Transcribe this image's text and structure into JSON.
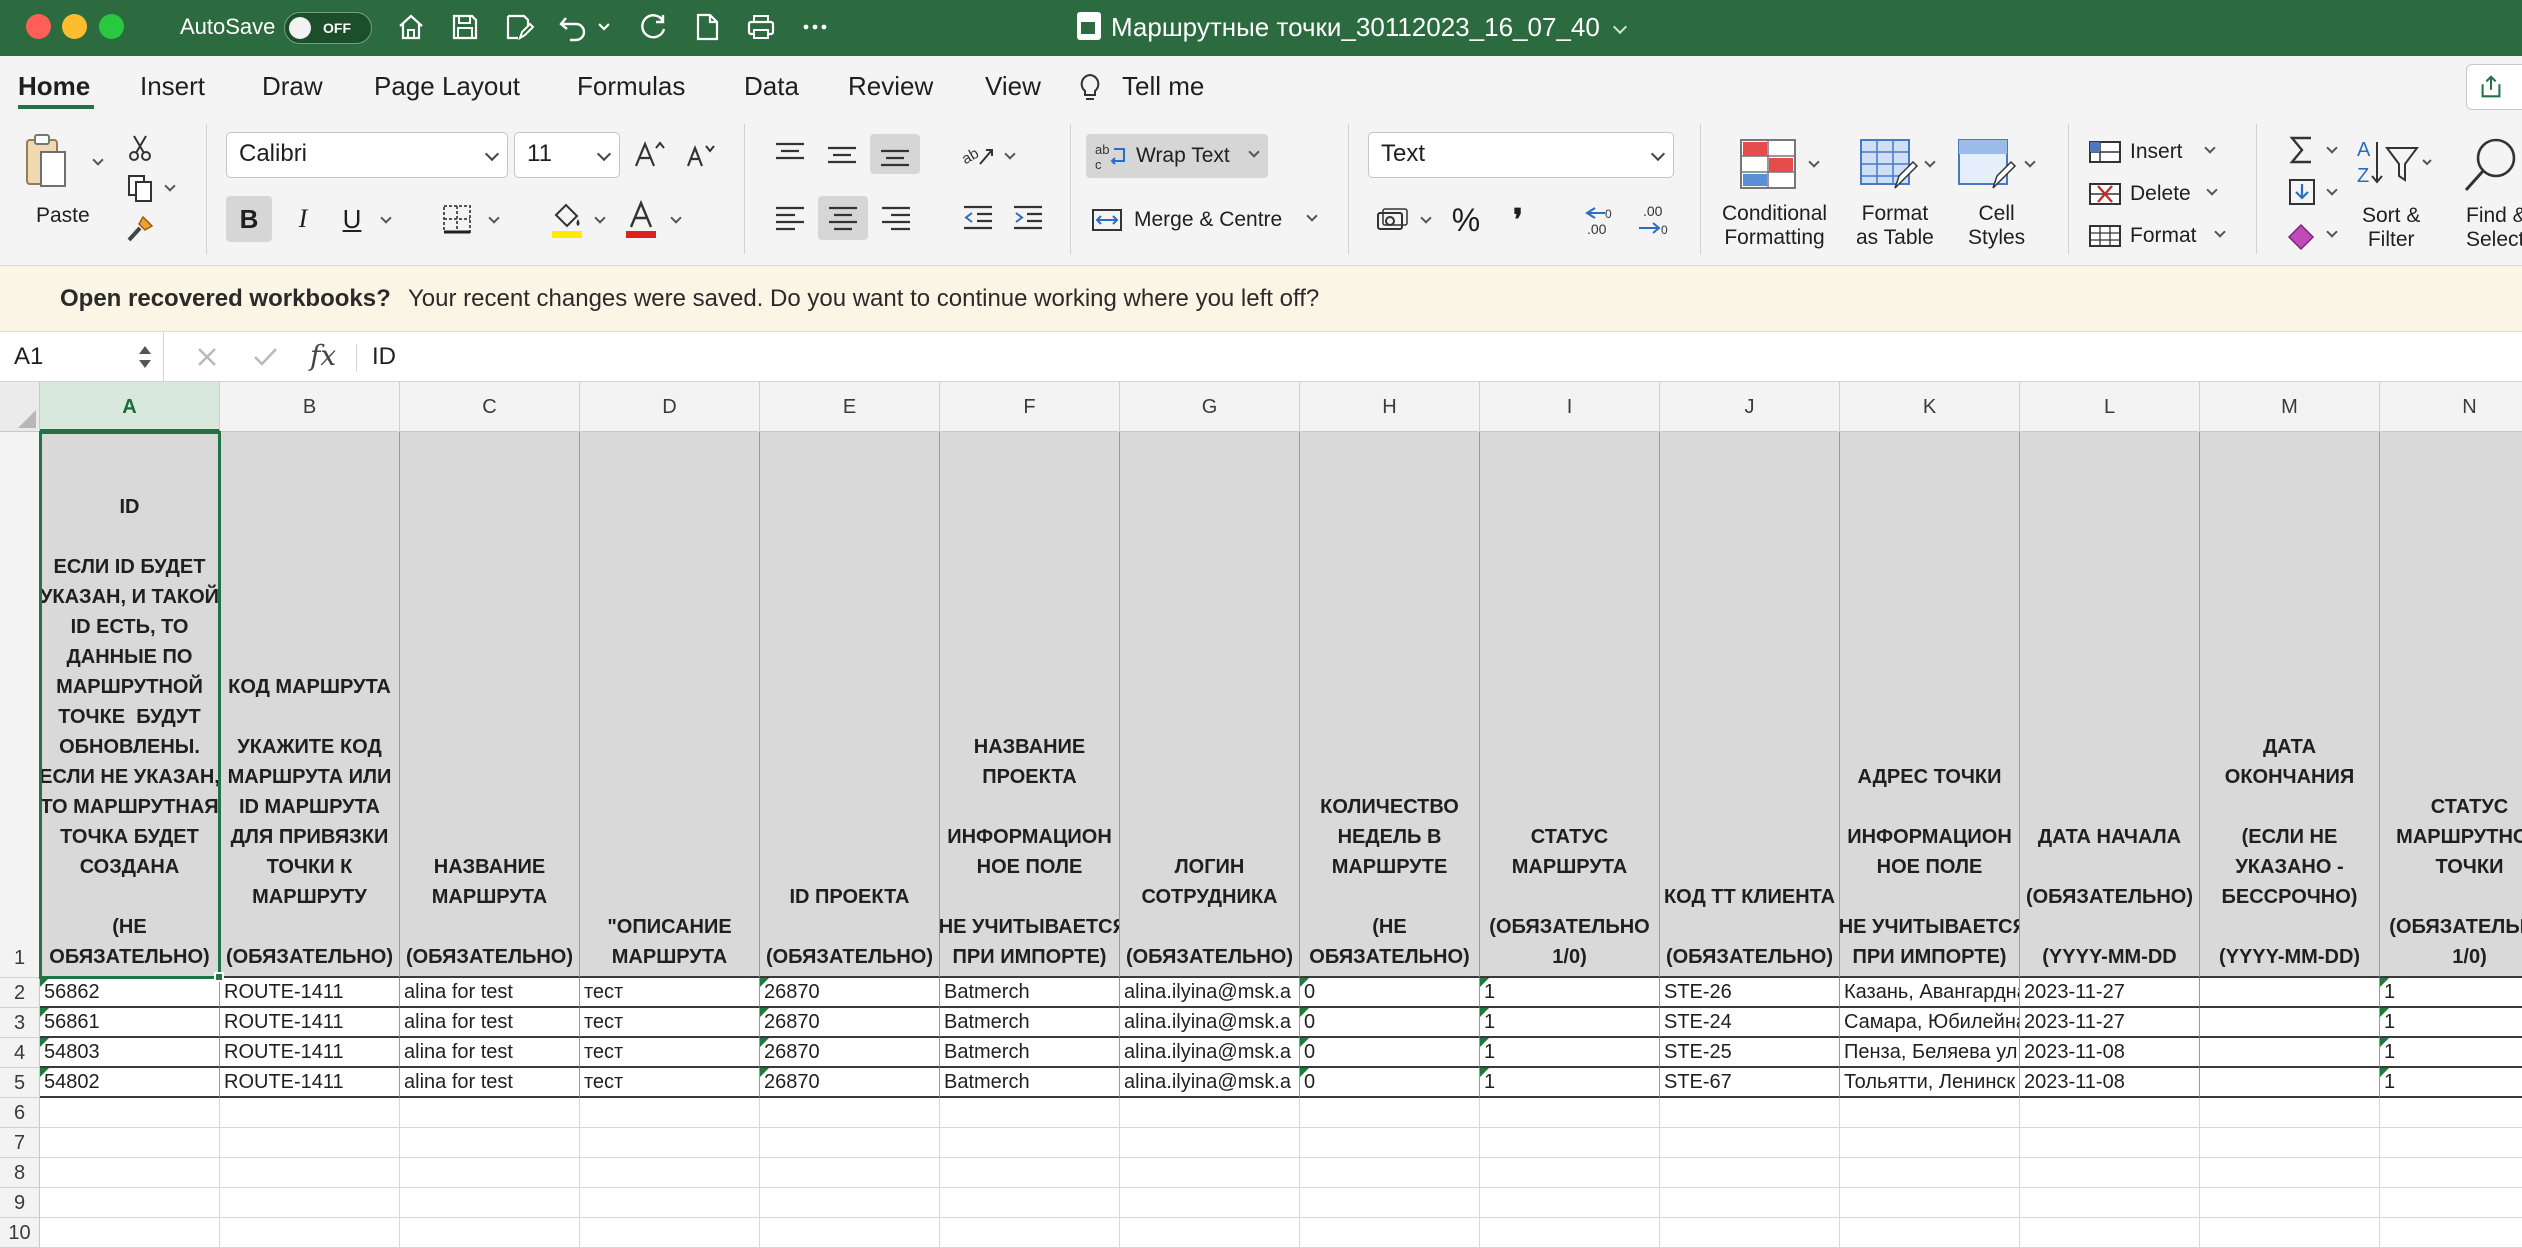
{
  "window": {
    "title": "Маршрутные точки_30112023_16_07_40",
    "autosave_label": "AutoSave",
    "autosave_state": "OFF"
  },
  "menu": {
    "tabs": [
      "Home",
      "Insert",
      "Draw",
      "Page Layout",
      "Formulas",
      "Data",
      "Review",
      "View"
    ],
    "tell_me": "Tell me",
    "active_tab": "Home"
  },
  "ribbon": {
    "paste_label": "Paste",
    "font_name": "Calibri",
    "font_size": "11",
    "wrap_text_label": "Wrap Text",
    "merge_label": "Merge & Centre",
    "number_format": "Text",
    "conditional_formatting_label": [
      "Conditional",
      "Formatting"
    ],
    "format_as_table_label": [
      "Format",
      "as Table"
    ],
    "cell_styles_label": [
      "Cell",
      "Styles"
    ],
    "insert_label": "Insert",
    "delete_label": "Delete",
    "format_label": "Format",
    "sort_filter_label": [
      "Sort &",
      "Filter"
    ],
    "find_select_label": [
      "Find &",
      "Select"
    ],
    "bold": "B",
    "italic": "I",
    "underline": "U",
    "percent": "%",
    "comma": "❜",
    "font_color": "#e0201b",
    "highlight_color": "#ffeb00",
    "accent": "#217346"
  },
  "notification": {
    "title": "Open recovered workbooks?",
    "message": "Your recent changes were saved. Do you want to continue working where you left off?"
  },
  "formula_bar": {
    "cell_ref": "A1",
    "fx": "fx",
    "value": "ID"
  },
  "sheet": {
    "columns": [
      "A",
      "B",
      "C",
      "D",
      "E",
      "F",
      "G",
      "H",
      "I",
      "J",
      "K",
      "L",
      "M",
      "N"
    ],
    "selected_column": "A",
    "row_numbers": [
      "1",
      "2",
      "3",
      "4",
      "5",
      "6",
      "7",
      "8",
      "9",
      "10"
    ],
    "header_cells": [
      [
        "ID",
        "",
        "ЕСЛИ ID БУДЕТ",
        "УКАЗАН, И ТАКОЙ",
        "ID ЕСТЬ, ТО",
        "ДАННЫЕ ПО",
        "МАРШРУТНОЙ",
        "ТОЧКЕ  БУДУТ",
        "ОБНОВЛЕНЫ.",
        "ЕСЛИ НЕ УКАЗАН,",
        "ТО МАРШРУТНАЯ",
        "ТОЧКА БУДЕТ",
        "СОЗДАНА",
        "",
        "(НЕ",
        "ОБЯЗАТЕЛЬНО)"
      ],
      [
        "КОД МАРШРУТА",
        "",
        "УКАЖИТЕ КОД",
        "МАРШРУТА ИЛИ",
        "ID МАРШРУТА",
        "ДЛЯ ПРИВЯЗКИ",
        "ТОЧКИ К",
        "МАРШРУТУ",
        "",
        "(ОБЯЗАТЕЛЬНО)"
      ],
      [
        "НАЗВАНИЕ",
        "МАРШРУТА",
        "",
        "(ОБЯЗАТЕЛЬНО)"
      ],
      [
        "\"ОПИСАНИЕ",
        "МАРШРУТА"
      ],
      [
        "ID ПРОЕКТА",
        "",
        "(ОБЯЗАТЕЛЬНО)"
      ],
      [
        "НАЗВАНИЕ",
        "ПРОЕКТА",
        "",
        "ИНФОРМАЦИОН",
        "НОЕ ПОЛЕ",
        "",
        "(НЕ УЧИТЫВАЕТСЯ",
        "ПРИ ИМПОРТЕ)"
      ],
      [
        "ЛОГИН",
        "СОТРУДНИКА",
        "",
        "(ОБЯЗАТЕЛЬНО)"
      ],
      [
        "КОЛИЧЕСТВО",
        "НЕДЕЛЬ В",
        "МАРШРУТЕ",
        "",
        "(НЕ",
        "ОБЯЗАТЕЛЬНО)"
      ],
      [
        "СТАТУС",
        "МАРШРУТА",
        "",
        "(ОБЯЗАТЕЛЬНО",
        "1/0)"
      ],
      [
        "КОД ТТ КЛИЕНТА",
        "",
        "(ОБЯЗАТЕЛЬНО)"
      ],
      [
        "АДРЕС ТОЧКИ",
        "",
        "ИНФОРМАЦИОН",
        "НОЕ ПОЛЕ",
        "",
        "(НЕ УЧИТЫВАЕТСЯ",
        "ПРИ ИМПОРТЕ)"
      ],
      [
        "ДАТА НАЧАЛА",
        "",
        "(ОБЯЗАТЕЛЬНО)",
        "",
        "(YYYY-MM-DD"
      ],
      [
        "ДАТА",
        "ОКОНЧАНИЯ",
        "",
        "(ЕСЛИ НЕ",
        "УКАЗАНО -",
        "БЕССРОЧНО)",
        "",
        "(YYYY-MM-DD)"
      ],
      [
        "СТАТУС",
        "МАРШРУТНОЙ",
        "ТОЧКИ",
        "",
        "(ОБЯЗАТЕЛЬНО",
        "1/0)"
      ]
    ],
    "rows": [
      [
        "56862",
        "ROUTE-1411",
        "alina for test",
        "тест",
        "26870",
        "Batmerch",
        "alina.ilyina@msk.a",
        "0",
        "1",
        "STE-26",
        "Казань, Авангардна",
        "2023-11-27",
        "",
        "1"
      ],
      [
        "56861",
        "ROUTE-1411",
        "alina for test",
        "тест",
        "26870",
        "Batmerch",
        "alina.ilyina@msk.a",
        "0",
        "1",
        "STE-24",
        "Самара, Юбилейна",
        "2023-11-27",
        "",
        "1"
      ],
      [
        "54803",
        "ROUTE-1411",
        "alina for test",
        "тест",
        "26870",
        "Batmerch",
        "alina.ilyina@msk.a",
        "0",
        "1",
        "STE-25",
        "Пенза, Беляева ул,",
        "2023-11-08",
        "",
        "1"
      ],
      [
        "54802",
        "ROUTE-1411",
        "alina for test",
        "тест",
        "26870",
        "Batmerch",
        "alina.ilyina@msk.a",
        "0",
        "1",
        "STE-67",
        "Тольятти, Ленинск",
        "2023-11-08",
        "",
        "1"
      ]
    ]
  }
}
